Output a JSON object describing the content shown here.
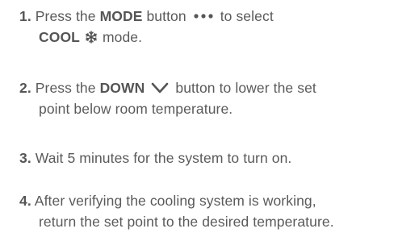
{
  "steps": [
    {
      "number": "1.",
      "pre": "Press the",
      "key": "MODE",
      "mid": "button",
      "icon": "dots-icon",
      "post": "to select",
      "line2_key": "COOL",
      "line2_icon": "snowflake-icon",
      "line2_post": "mode."
    },
    {
      "number": "2.",
      "pre": "Press the",
      "key": "DOWN",
      "icon": "chevron-down-icon",
      "post": "button to lower the set",
      "line2": "point below room temperature."
    },
    {
      "number": "3.",
      "text": "Wait 5 minutes for the system to turn on."
    },
    {
      "number": "4.",
      "text": "After verifying the cooling system is working,",
      "line2": "return the set point to the desired temperature."
    }
  ],
  "colors": {
    "text": "#5a5a5a",
    "icon": "#555555"
  }
}
